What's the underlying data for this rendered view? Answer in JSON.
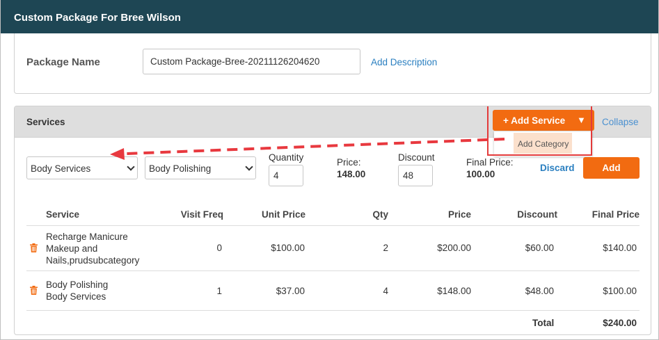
{
  "header": {
    "title": "Custom Package For Bree Wilson"
  },
  "package": {
    "label": "Package Name",
    "value": "Custom Package-Bree-20211126204620",
    "add_description": "Add Description"
  },
  "services": {
    "title": "Services",
    "add_service_label": "+ Add Service",
    "dropdown_caret": "▼",
    "dropdown_items": [
      "Add Category"
    ],
    "collapse_label": "Collapse",
    "form": {
      "category_select": "Body Services",
      "service_select": "Body Polishing",
      "quantity_label": "Quantity",
      "quantity_value": "4",
      "price_label": "Price:",
      "price_value": "148.00",
      "discount_label": "Discount",
      "discount_value": "48",
      "final_price_label": "Final Price:",
      "final_price_value": "100.00",
      "discard_label": "Discard",
      "add_label": "Add"
    },
    "table": {
      "headers": [
        "Service",
        "Visit Freq",
        "Unit Price",
        "Qty",
        "Price",
        "Discount",
        "Final Price"
      ],
      "rows": [
        {
          "service_lines": [
            "Recharge Manicure",
            "Makeup and",
            "Nails,prudsubcategory"
          ],
          "visit_freq": "0",
          "unit_price": "$100.00",
          "qty": "2",
          "price": "$200.00",
          "discount": "$60.00",
          "final_price": "$140.00"
        },
        {
          "service_lines": [
            "Body Polishing",
            "Body Services"
          ],
          "visit_freq": "1",
          "unit_price": "$37.00",
          "qty": "4",
          "price": "$148.00",
          "discount": "$48.00",
          "final_price": "$100.00"
        }
      ],
      "total_label": "Total",
      "total_value": "$240.00"
    }
  },
  "colors": {
    "header_bg": "#1e4654",
    "accent_orange": "#f26b11",
    "link_blue": "#2a7fc0",
    "highlight_red": "#e33a3a"
  }
}
